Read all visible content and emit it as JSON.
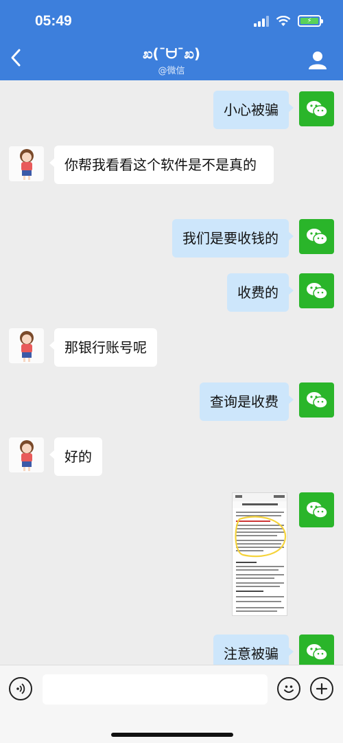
{
  "status_bar": {
    "time": "05:49"
  },
  "header": {
    "back_icon": "chevron-left-icon",
    "title": "ಖ(¯ᗨ¯ಖ)",
    "subtitle": "@微信",
    "profile_icon": "person-icon"
  },
  "messages": [
    {
      "side": "right",
      "text": "小心被骗"
    },
    {
      "side": "left",
      "text": "你帮我看看这个软件是不是真的"
    },
    {
      "side": "right",
      "text": "我们是要收钱的"
    },
    {
      "side": "right",
      "text": "收费的"
    },
    {
      "side": "left",
      "text": "那银行账号呢"
    },
    {
      "side": "right",
      "text": "查询是收费"
    },
    {
      "side": "left",
      "text": "好的"
    },
    {
      "side": "right",
      "type": "image"
    },
    {
      "side": "right",
      "text": "注意被骗"
    }
  ],
  "input": {
    "voice_icon": "voice-icon",
    "emoji_icon": "emoji-icon",
    "plus_icon": "plus-icon"
  },
  "colors": {
    "header_bg": "#3d7fdc",
    "bubble_right": "#cde6fb",
    "bubble_left": "#ffffff",
    "wechat_green": "#2ab52a"
  }
}
